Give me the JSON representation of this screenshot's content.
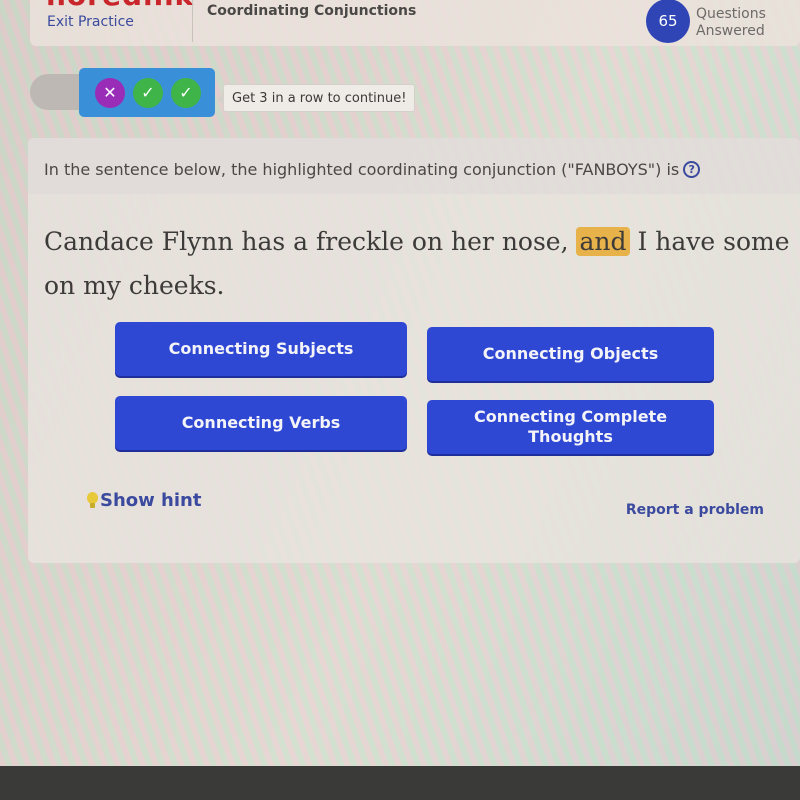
{
  "header": {
    "logo_text": "noredink",
    "exit_label": "Exit Practice",
    "topic_title": "Coordinating Conjunctions",
    "questions_answered_count": "65",
    "questions_answered_label": "Questions Answered",
    "accent_color": "#2f45b5"
  },
  "streak": {
    "results": [
      {
        "status": "wrong",
        "icon": "x-icon",
        "glyph": "✕"
      },
      {
        "status": "correct",
        "icon": "check-icon",
        "glyph": "✓"
      },
      {
        "status": "correct",
        "icon": "check-icon",
        "glyph": "✓"
      }
    ],
    "tooltip": "Get 3 in a row to continue!"
  },
  "question": {
    "prompt": "In the sentence below, the highlighted coordinating conjunction (\"FANBOYS\") is",
    "help_icon": "question-mark-icon",
    "sentence_before": "Candace Flynn has a freckle on her nose, ",
    "sentence_highlight": "and",
    "sentence_after": " I have some on my cheeks.",
    "answers": [
      "Connecting Subjects",
      "Connecting Objects",
      "Connecting Verbs",
      "Connecting Complete Thoughts"
    ],
    "hint_label": "Show hint",
    "hint_icon": "lightbulb-icon",
    "report_label": "Report a problem"
  }
}
